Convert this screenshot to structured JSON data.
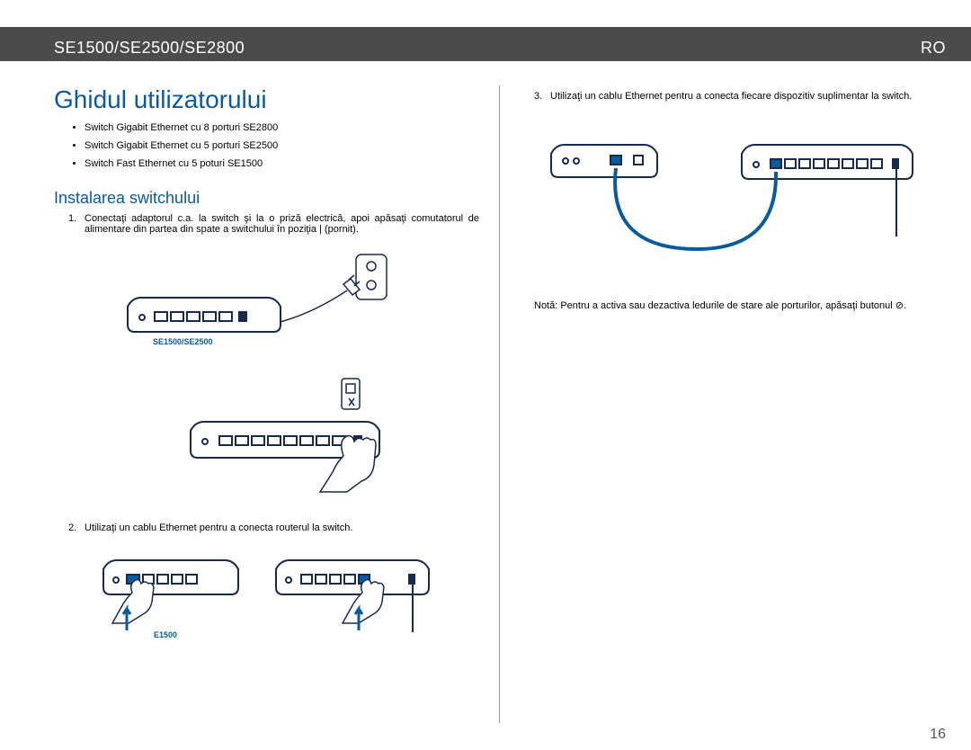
{
  "header": {
    "model": "SE1500/SE2500/SE2800",
    "lang": "RO"
  },
  "title": "Ghidul utilizatorului",
  "bullets": [
    "Switch Gigabit Ethernet cu 8 porturi SE2800",
    "Switch Gigabit Ethernet cu 5 porturi SE2500",
    "Switch Fast Ethernet cu 5 poturi SE1500"
  ],
  "section_install": "Instalarea switchului",
  "steps": {
    "s1_num": "1.",
    "s1": "Conectaţi adaptorul c.a. la switch şi la o priză electrică, apoi apăsaţi comutatorul de alimentare din partea din spate a switchului în poziţia | (pornit).",
    "s2_num": "2.",
    "s2": "Utilizaţi un cablu Ethernet pentru a conecta routerul la switch.",
    "s3_num": "3.",
    "s3": "Utilizaţi un cablu Ethernet pentru a conecta fiecare dispozitiv suplimentar la switch."
  },
  "note": "Notă: Pentru a activa sau dezactiva ledurile de stare ale porturilor, apăsaţi butonul ⊘.",
  "fig_labels": {
    "top_switch": "SE1500/SE2500",
    "bottom_left": "E1500"
  },
  "page_number": "16"
}
